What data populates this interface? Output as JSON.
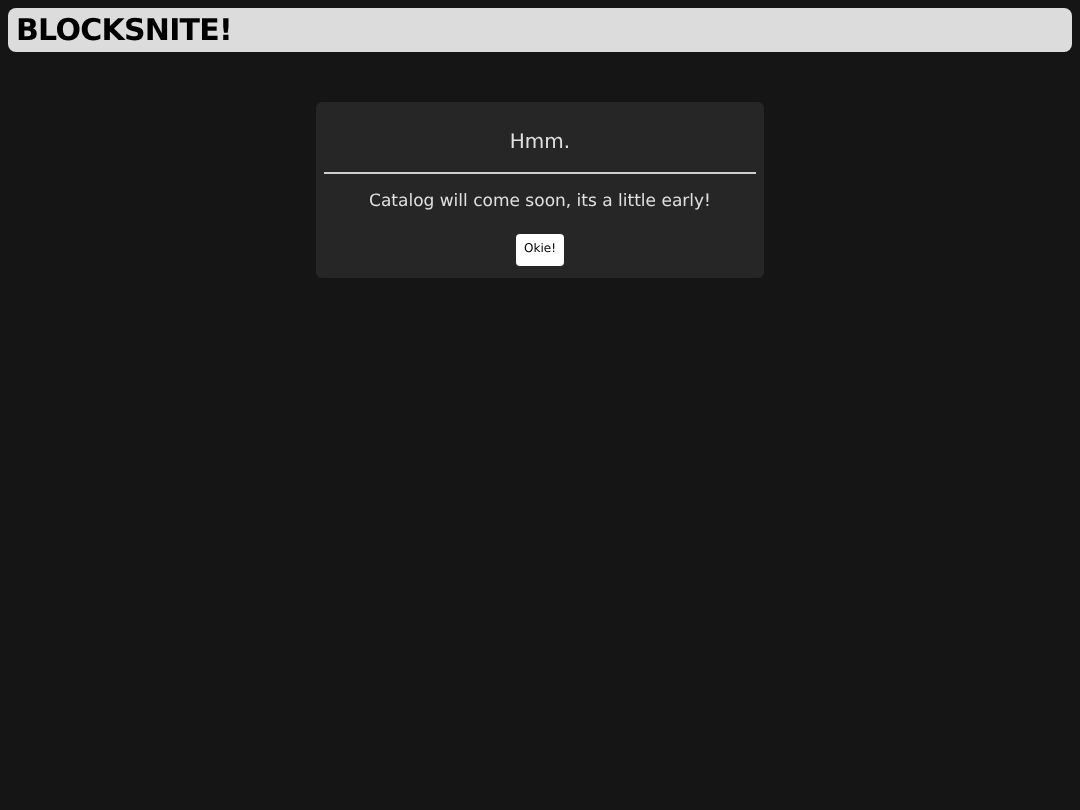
{
  "header": {
    "title": "BLOCKSNITE!"
  },
  "dialog": {
    "title": "Hmm.",
    "message": "Catalog will come soon, its a little early!",
    "button": "Okie!"
  }
}
